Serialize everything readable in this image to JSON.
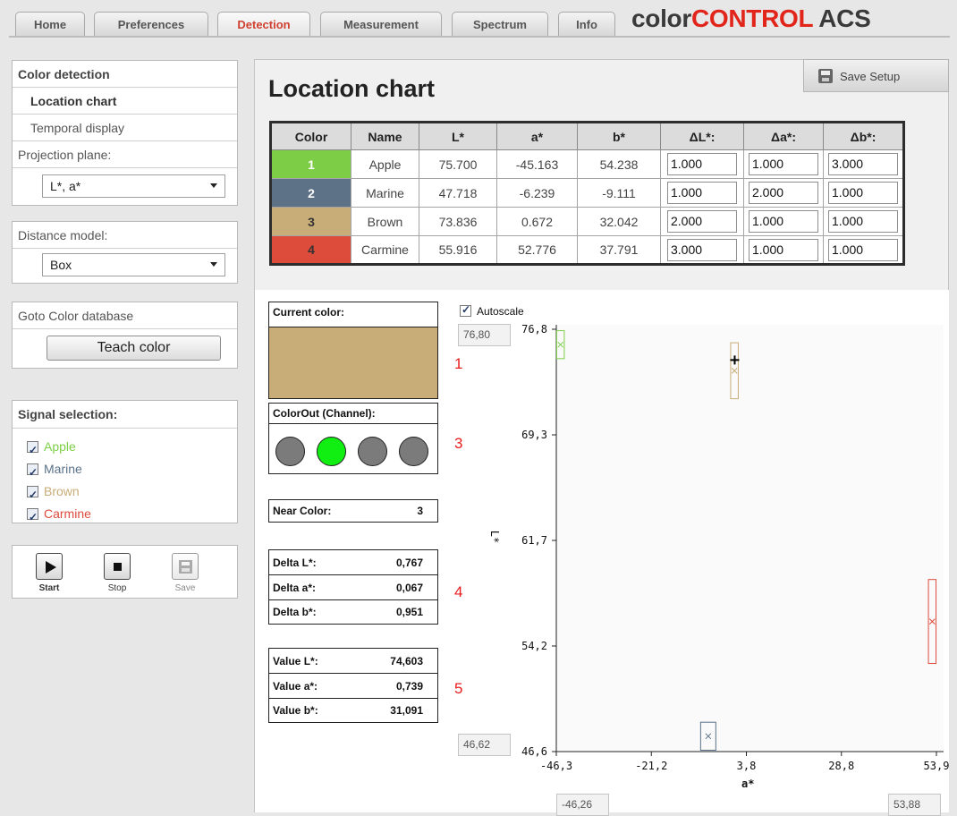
{
  "tabs": [
    {
      "label": "Home"
    },
    {
      "label": "Preferences"
    },
    {
      "label": "Detection"
    },
    {
      "label": "Measurement"
    },
    {
      "label": "Spectrum"
    },
    {
      "label": "Info"
    }
  ],
  "brand": {
    "part1": "color",
    "part2": "CONTROL",
    "part3": " ACS"
  },
  "sidebar": {
    "detection_header": "Color detection",
    "location_chart": "Location chart",
    "temporal_display": "Temporal display",
    "projection_label": "Projection plane:",
    "projection_value": "L*, a*",
    "distance_label": "Distance model:",
    "distance_value": "Box",
    "goto_db": "Goto Color database",
    "teach_color": "Teach color",
    "signal_header": "Signal selection:",
    "signals": [
      {
        "label": "Apple",
        "color": "#7ccf47"
      },
      {
        "label": "Marine",
        "color": "#5b7289"
      },
      {
        "label": "Brown",
        "color": "#c8ac77"
      },
      {
        "label": "Carmine",
        "color": "#de4a3c"
      }
    ],
    "start_label": "Start",
    "stop_label": "Stop",
    "save_label": "Save"
  },
  "main": {
    "title": "Location chart",
    "save_setup": "Save Setup",
    "table": {
      "headers": [
        "Color",
        "Name",
        "L*",
        "a*",
        "b*",
        "ΔL*:",
        "Δa*:",
        "Δb*:"
      ],
      "rows": [
        {
          "id": "1",
          "color": "#7dcd46",
          "name": "Apple",
          "L": "75.700",
          "a": "-45.163",
          "b": "54.238",
          "dL": "1.000",
          "da": "1.000",
          "db": "3.000"
        },
        {
          "id": "2",
          "color": "#5d7286",
          "name": "Marine",
          "L": "47.718",
          "a": "-6.239",
          "b": "-9.111",
          "dL": "1.000",
          "da": "2.000",
          "db": "1.000"
        },
        {
          "id": "3",
          "color": "#c8ad78",
          "name": "Brown",
          "L": "73.836",
          "a": "0.672",
          "b": "32.042",
          "dL": "2.000",
          "da": "1.000",
          "db": "1.000"
        },
        {
          "id": "4",
          "color": "#dd4b3b",
          "name": "Carmine",
          "L": "55.916",
          "a": "52.776",
          "b": "37.791",
          "dL": "3.000",
          "da": "1.000",
          "db": "1.000"
        }
      ]
    },
    "current_color_label": "Current color:",
    "current_color": "#c8ad78",
    "colorout_label": "ColorOut (Channel):",
    "channel_on_index": 1,
    "near_color_label": "Near Color:",
    "near_color_value": "3",
    "delta": [
      {
        "label": "Delta L*:",
        "value": "0,767"
      },
      {
        "label": "Delta a*:",
        "value": "0,067"
      },
      {
        "label": "Delta b*:",
        "value": "0,951"
      }
    ],
    "values": [
      {
        "label": "Value L*:",
        "value": "74,603"
      },
      {
        "label": "Value a*:",
        "value": "0,739"
      },
      {
        "label": "Value b*:",
        "value": "31,091"
      }
    ],
    "annotations": [
      "1",
      "2",
      "3",
      "4",
      "5"
    ]
  },
  "plot": {
    "autoscale_label": "Autoscale",
    "y_max_box": "76,80",
    "y_min_box": "46,62",
    "x_min_box": "-46,26",
    "x_max_box": "53,88",
    "y_axis_label": "L*",
    "x_axis_label": "a*",
    "y_ticks": [
      "76,8",
      "69,3",
      "61,7",
      "54,2",
      "46,6"
    ],
    "x_ticks": [
      "-46,3",
      "-21,2",
      "3,8",
      "28,8",
      "53,9"
    ]
  },
  "chart_data": {
    "type": "scatter",
    "xlabel": "a*",
    "ylabel": "L*",
    "xlim": [
      -46.26,
      53.88
    ],
    "ylim": [
      46.62,
      76.8
    ],
    "series": [
      {
        "name": "Apple",
        "color": "#7ccf47",
        "x": [
          -45.163
        ],
        "y": [
          75.7
        ],
        "box_half": {
          "a": 1.0,
          "L": 1.0
        }
      },
      {
        "name": "Marine",
        "color": "#5b7289",
        "x": [
          -6.239
        ],
        "y": [
          47.718
        ],
        "box_half": {
          "a": 2.0,
          "L": 1.0
        }
      },
      {
        "name": "Brown",
        "color": "#c8ac77",
        "x": [
          0.672
        ],
        "y": [
          73.836
        ],
        "box_half": {
          "a": 1.0,
          "L": 2.0
        }
      },
      {
        "name": "Carmine",
        "color": "#de4a3c",
        "x": [
          52.776
        ],
        "y": [
          55.916
        ],
        "box_half": {
          "a": 1.0,
          "L": 3.0
        }
      }
    ],
    "current": {
      "x": 0.739,
      "y": 74.603
    }
  }
}
